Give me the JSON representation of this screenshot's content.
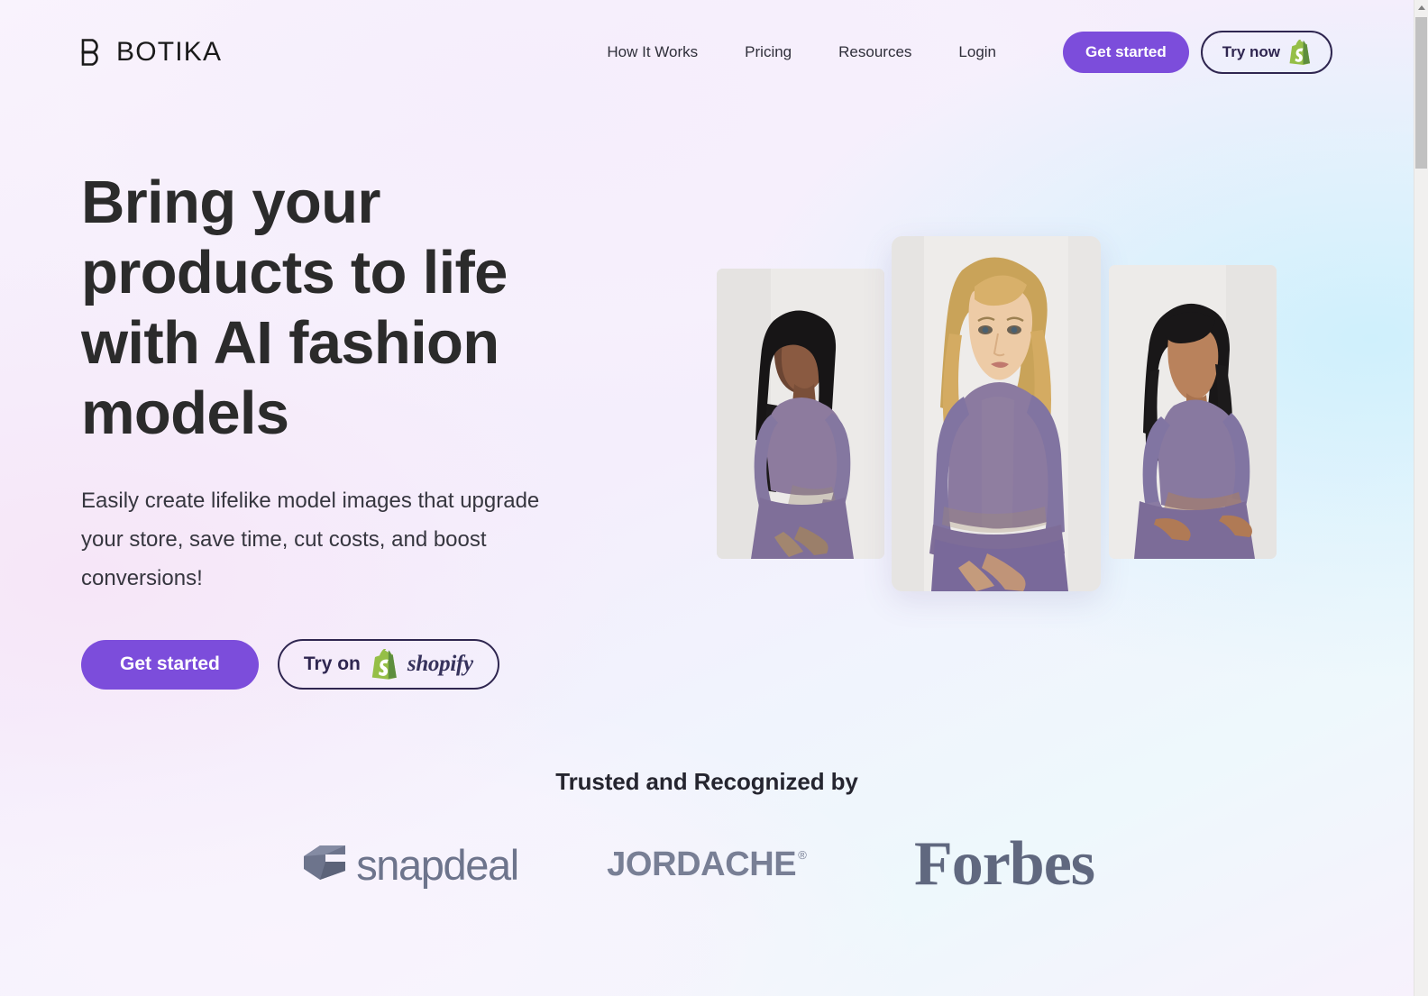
{
  "brand": {
    "name": "BOTIKA",
    "mark_icon": "botika-b-mark-icon"
  },
  "header": {
    "nav": [
      {
        "label": "How It Works"
      },
      {
        "label": "Pricing"
      },
      {
        "label": "Resources"
      },
      {
        "label": "Login"
      }
    ],
    "get_started_label": "Get started",
    "try_now_label": "Try now",
    "shopify_icon": "shopify-bag-icon",
    "accent_color": "#7C4DDB",
    "outline_color": "#2F2650"
  },
  "hero": {
    "title": "Bring your products to life with AI fashion models",
    "subtitle": "Easily create lifelike model images that upgrade your store, save time, cut costs, and boost conversions!",
    "get_started_label": "Get started",
    "try_on_label": "Try on",
    "shopify_wordmark": "shopify",
    "shopify_icon": "shopify-bag-icon",
    "gallery": [
      {
        "alt": "AI fashion model in purple long-sleeve crop top and leggings, front view",
        "position": "left"
      },
      {
        "alt": "AI fashion model with blonde hair in purple ribbed crop top and leggings, front view",
        "position": "center"
      },
      {
        "alt": "AI fashion model in purple crop top and leggings, back view",
        "position": "right"
      }
    ]
  },
  "trusted": {
    "title": "Trusted and Recognized by",
    "logos": [
      {
        "name": "snapdeal",
        "text": "snapdeal",
        "icon": "snapdeal-box-icon",
        "color": "#6D748C"
      },
      {
        "name": "jordache",
        "text": "JORDACHE",
        "trademark": "®",
        "color": "#787F95"
      },
      {
        "name": "forbes",
        "text": "Forbes",
        "color": "#60687F"
      }
    ]
  },
  "browser": {
    "scrollbar_icon": "scroll-up-arrow-icon"
  }
}
